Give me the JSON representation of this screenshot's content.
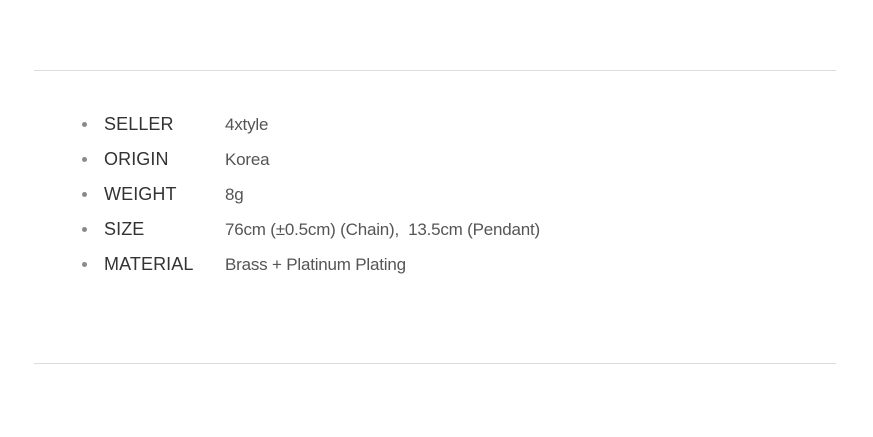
{
  "specs": [
    {
      "label": "SELLER",
      "value": "4xtyle"
    },
    {
      "label": "ORIGIN",
      "value": "Korea"
    },
    {
      "label": "WEIGHT",
      "value": "8g"
    },
    {
      "label": "SIZE",
      "value": "76cm (±0.5cm) (Chain),  13.5cm (Pendant)"
    },
    {
      "label": "MATERIAL",
      "value": "Brass + Platinum Plating"
    }
  ],
  "colors": {
    "label": "#333333",
    "value": "#555555",
    "bullet": "#8a8a8a",
    "divider": "#dcdcdc"
  }
}
